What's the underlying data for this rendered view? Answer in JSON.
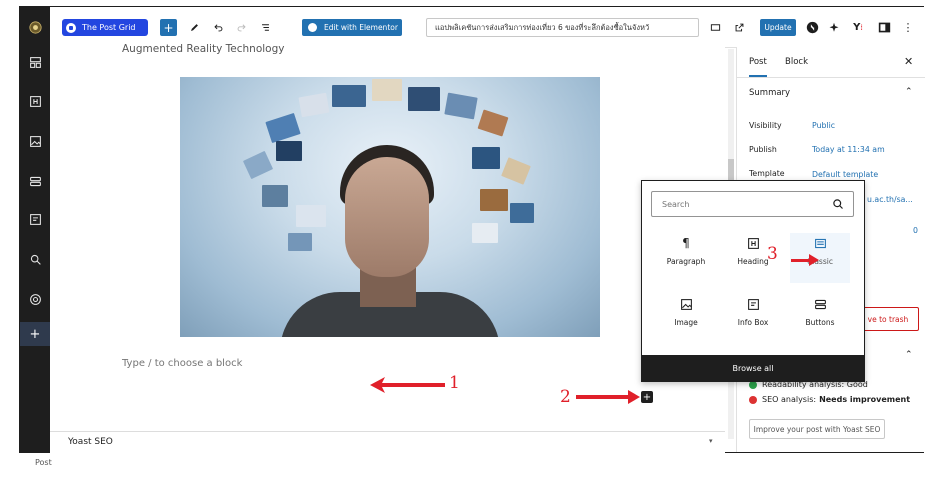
{
  "toolbar": {
    "post_grid_label": "The Post Grid",
    "elementor_label": "Edit with Elementor",
    "document_title": "แอปพลิเคชันการส่งเสริมการท่องเที่ยว 6 ของที่ระลึกต้องซื้อในจังหวั",
    "update_label": "Update"
  },
  "editor": {
    "heading_text": "Augmented Reality Technology",
    "block_placeholder": "Type / to choose a block",
    "annotation_1": "1",
    "annotation_2": "2",
    "annotation_3": "3"
  },
  "yoast_bar": {
    "title": "Yoast SEO"
  },
  "sidebar": {
    "tab_post": "Post",
    "tab_block": "Block",
    "section_summary": "Summary",
    "visibility_label": "Visibility",
    "visibility_value": "Public",
    "publish_label": "Publish",
    "publish_value": "Today at 11:34 am",
    "template_label": "Template",
    "template_value": "Default template",
    "url_value": "u.ac.th/sa...",
    "revisions_value": "0",
    "trash_label": "ve to trash",
    "readability": "Readability analysis: Good",
    "seo_prefix": "SEO analysis: ",
    "seo_value": "Needs improvement",
    "improve_label": "Improve your post with Yoast SEO"
  },
  "inserter": {
    "search_placeholder": "Search",
    "blocks": [
      {
        "label": "Paragraph",
        "icon": "paragraph-icon"
      },
      {
        "label": "Heading",
        "icon": "heading-icon"
      },
      {
        "label": "Classic",
        "icon": "classic-icon"
      },
      {
        "label": "Image",
        "icon": "image-icon"
      },
      {
        "label": "Info Box",
        "icon": "info-box-icon"
      },
      {
        "label": "Buttons",
        "icon": "buttons-icon"
      }
    ],
    "browse_all": "Browse all"
  },
  "footer": {
    "status": "Post"
  },
  "colors": {
    "accent": "#2271b1",
    "dark": "#1e1e1e",
    "annotation_red": "#e0202a"
  }
}
